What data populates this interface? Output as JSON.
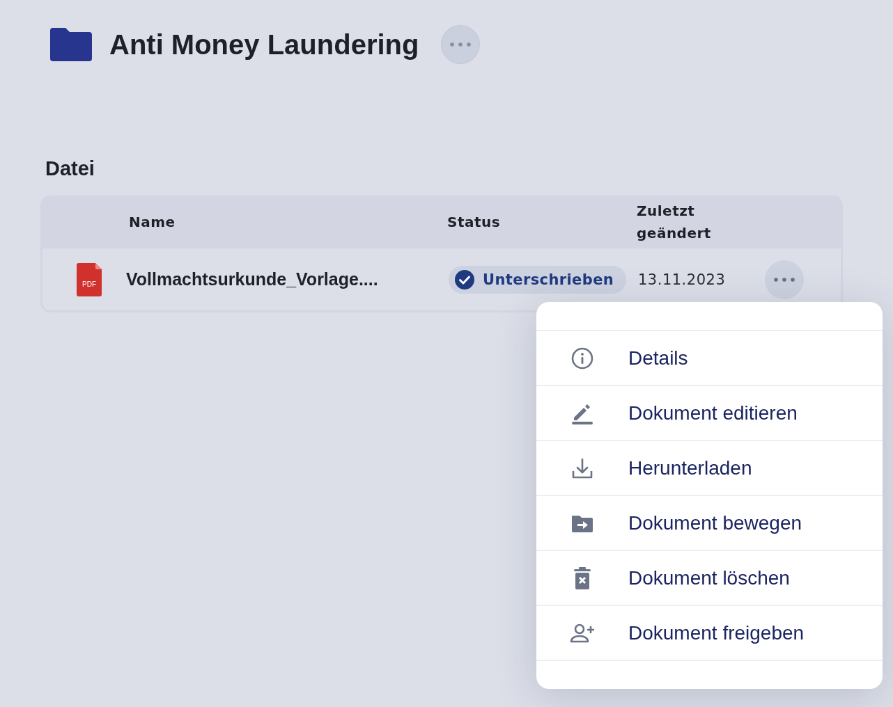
{
  "folder": {
    "title": "Anti Money Laundering"
  },
  "section": {
    "title": "Datei"
  },
  "table": {
    "columns": [
      "Name",
      "Status",
      "Zuletzt geändert"
    ],
    "rows": [
      {
        "name": "Vollmachtsurkunde_Vorlage....",
        "file_type": "PDF",
        "status": "Unterschrieben",
        "modified": "13.11.2023"
      }
    ]
  },
  "menu": {
    "items": [
      {
        "kind": "info",
        "label": "Details"
      },
      {
        "kind": "edit",
        "label": "Dokument editieren"
      },
      {
        "kind": "download",
        "label": "Herunterladen"
      },
      {
        "kind": "move",
        "label": "Dokument bewegen"
      },
      {
        "kind": "delete",
        "label": "Dokument löschen"
      },
      {
        "kind": "share",
        "label": "Dokument freigeben"
      }
    ]
  }
}
